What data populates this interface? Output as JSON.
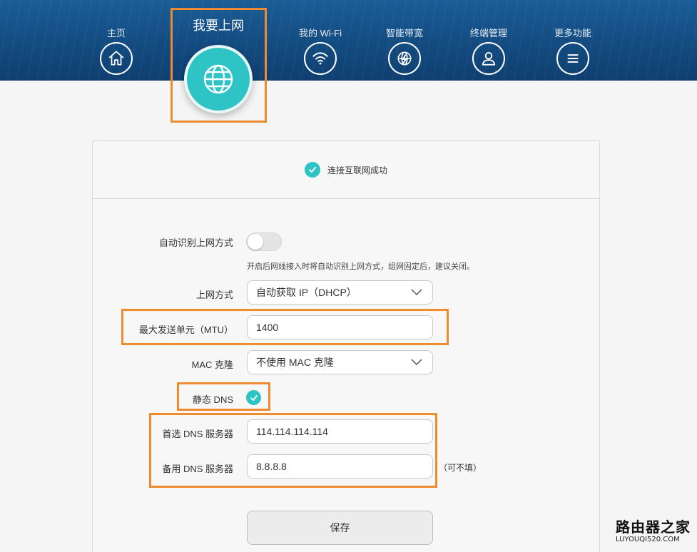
{
  "nav": {
    "items": [
      {
        "label": "主页",
        "icon": "home-icon"
      },
      {
        "label": "我的 Wi-Fi",
        "icon": "wifi-icon"
      },
      {
        "label": "智能带宽",
        "icon": "bandwidth-icon"
      },
      {
        "label": "终端管理",
        "icon": "user-icon"
      },
      {
        "label": "更多功能",
        "icon": "menu-icon"
      }
    ],
    "active": {
      "label": "我要上网",
      "icon": "globe-icon"
    }
  },
  "status": {
    "text": "连接互联网成功",
    "icon": "check-icon"
  },
  "form": {
    "auto_detect": {
      "label": "自动识别上网方式",
      "enabled": false,
      "hint": "开启后网线接入时将自动识别上网方式，组网固定后，建议关闭。"
    },
    "connection_type": {
      "label": "上网方式",
      "value": "自动获取 IP（DHCP）"
    },
    "mtu": {
      "label": "最大发送单元（MTU）",
      "value": "1400"
    },
    "mac_clone": {
      "label": "MAC 克隆",
      "value": "不使用 MAC 克隆"
    },
    "static_dns": {
      "label": "静态 DNS",
      "checked": true
    },
    "primary_dns": {
      "label": "首选 DNS 服务器",
      "value": "114.114.114.114"
    },
    "secondary_dns": {
      "label": "备用 DNS 服务器",
      "value": "8.8.8.8",
      "note": "（可不填）"
    },
    "save_label": "保存"
  },
  "watermark": {
    "main": "路由器之家",
    "sub": "LUYOUQI520.COM"
  },
  "colors": {
    "accent": "#2ec4c6",
    "header": "#1a5a95",
    "highlight": "#ef8a2e"
  }
}
